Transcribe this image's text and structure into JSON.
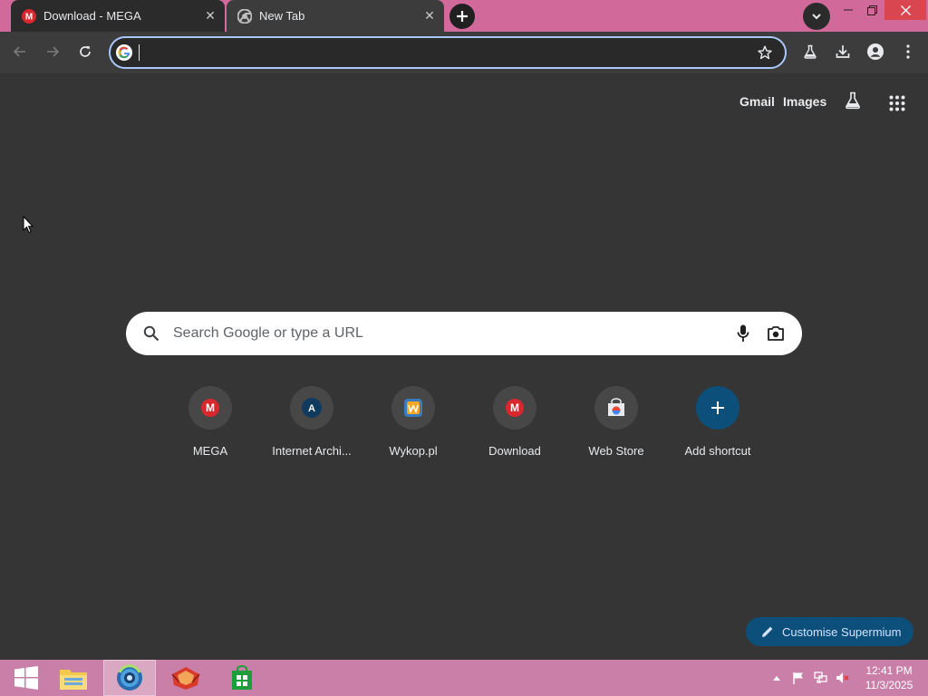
{
  "browser": {
    "tabs": [
      {
        "title": "Download - MEGA",
        "favicon": "mega-icon",
        "active": false
      },
      {
        "title": "New Tab",
        "favicon": "chrome-icon",
        "active": true
      }
    ],
    "new_tab_icon": "plus-icon",
    "tab_search_icon": "chevron-down-icon",
    "window_controls": {
      "minimize": "minimize-icon",
      "restore": "restore-icon",
      "close": "close-icon"
    },
    "colors": {
      "tabstrip": "#d2699b",
      "toolbar": "#3c3c3c",
      "page_bg": "#353535",
      "omnibox_focus": "#a8c7fa"
    }
  },
  "toolbar": {
    "back_icon": "back-arrow-icon",
    "forward_icon": "forward-arrow-icon",
    "reload_icon": "reload-icon",
    "omnibox": {
      "value": "",
      "placeholder": ""
    },
    "bookmark_icon": "star-icon",
    "right_icons": [
      "labs-icon",
      "download-icon",
      "profile-icon",
      "menu-icon"
    ]
  },
  "newtab": {
    "links": {
      "gmail": "Gmail",
      "images": "Images"
    },
    "labs_icon": "labs-icon",
    "apps_icon": "apps-grid-icon",
    "search": {
      "placeholder": "Search Google or type a URL"
    },
    "shortcuts": [
      {
        "label": "MEGA",
        "icon": "mega-icon"
      },
      {
        "label": "Internet Archi...",
        "icon": "archive-icon",
        "letter": "A"
      },
      {
        "label": "Wykop.pl",
        "icon": "wykop-icon"
      },
      {
        "label": "Download",
        "icon": "mega-icon"
      },
      {
        "label": "Web Store",
        "icon": "webstore-icon"
      },
      {
        "label": "Add shortcut",
        "icon": "plus-icon"
      }
    ],
    "customise_label": "Customise Supermium"
  },
  "taskbar": {
    "items": [
      "start-button",
      "file-explorer",
      "supermium-browser",
      "firefox-like-app",
      "store-app"
    ],
    "clock": {
      "time": "12:41 PM",
      "date": "11/3/2025"
    },
    "color": "#c97fa8"
  }
}
